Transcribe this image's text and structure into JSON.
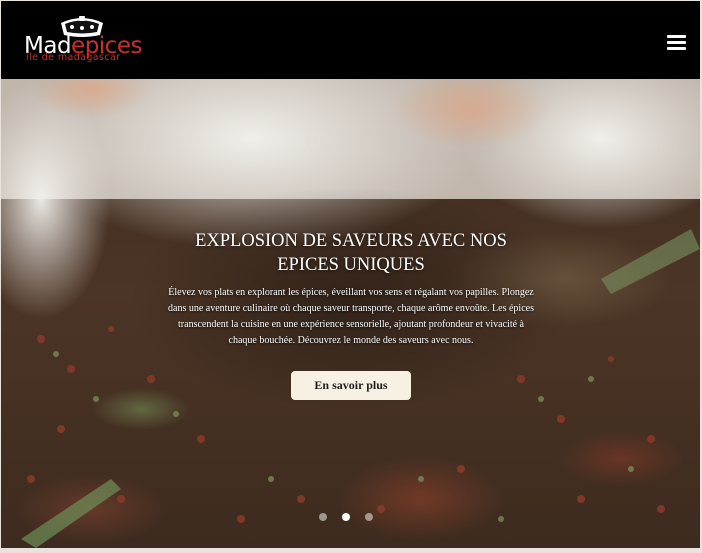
{
  "brand": {
    "name_part1": "Mad",
    "name_part2": "epices",
    "tagline": "ile de madagascar",
    "accent_color": "#c9302c"
  },
  "nav": {
    "menu_icon": "hamburger-menu-icon"
  },
  "hero": {
    "title": "EXPLOSION DE SAVEURS AVEC NOS EPICES UNIQUES",
    "description": "Élevez vos plats en explorant les épices, éveillant vos sens et régalant vos papilles. Plongez dans une aventure culinaire où chaque saveur transporte, chaque arôme envoûte. Les épices transcendent la cuisine en une expérience sensorielle, ajoutant profondeur et vivacité à chaque bouchée. Découvrez le monde des saveurs avec nous.",
    "cta_label": "En savoir plus",
    "background_image": "green-peppercorns-being-sorted-by-hand"
  },
  "carousel": {
    "slide_count": 3,
    "active_index": 1
  }
}
